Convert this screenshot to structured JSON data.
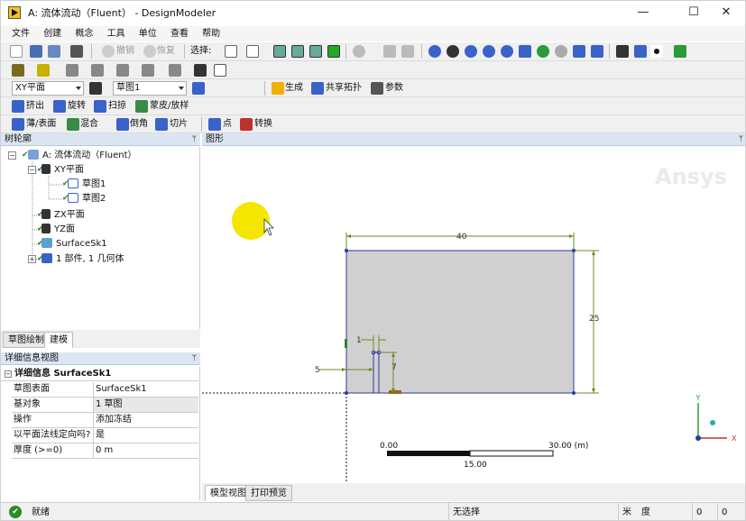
{
  "window": {
    "title": "A: 流体流动（Fluent） - DesignModeler",
    "minimize": "—",
    "maximize": "☐",
    "close": "✕"
  },
  "menu": [
    "文件",
    "创建",
    "概念",
    "工具",
    "单位",
    "查看",
    "帮助"
  ],
  "toolbar1": {
    "undo": "撤销",
    "redo": "恢复",
    "select_label": "选择:"
  },
  "toolbar3": {
    "plane": "XY平面",
    "sketch": "草图1",
    "generate": "生成",
    "share_topology": "共享拓扑",
    "parameters": "参数"
  },
  "toolbar4": {
    "extrude": "挤出",
    "revolve": "旋转",
    "sweep": "扫掠",
    "skin_loft": "蒙皮/放样"
  },
  "toolbar5": {
    "thin_surface": "薄/表面",
    "blend": "混合",
    "chamfer": "倒角",
    "slice": "切片",
    "point": "点",
    "convert": "转换"
  },
  "tree_panel": {
    "title": "树轮廓",
    "pin": "ᛘ",
    "nodes": [
      {
        "label": "A: 流体流动（Fluent）"
      },
      {
        "label": "XY平面"
      },
      {
        "label": "草图1"
      },
      {
        "label": "草图2"
      },
      {
        "label": "ZX平面"
      },
      {
        "label": "YZ面"
      },
      {
        "label": "SurfaceSk1"
      },
      {
        "label": "1 部件, 1 几何体"
      }
    ]
  },
  "left_tabs": {
    "sketching": "草图绘制",
    "modeling": "建模"
  },
  "detail_panel": {
    "title": "详细信息视图",
    "section": "详细信息 SurfaceSk1",
    "rows": [
      {
        "key": "草图表面",
        "value": "SurfaceSk1"
      },
      {
        "key": "基对象",
        "value": "1 草图"
      },
      {
        "key": "操作",
        "value": "添加冻结"
      },
      {
        "key": "以平面法线定向吗?",
        "value": "是"
      },
      {
        "key": "厚度 (>=0)",
        "value": "0 m"
      }
    ]
  },
  "graphics": {
    "title": "图形",
    "watermark": "Ansys",
    "dimensions": {
      "width": "40",
      "height": "25",
      "offset": "5",
      "slot_width": "1",
      "slot_height": "7"
    },
    "scale_bar": {
      "left": "0.00",
      "right": "30.00 (m)",
      "mid": "15.00"
    },
    "axes": {
      "y": "Y",
      "x": "X"
    }
  },
  "bottom_tabs": {
    "model_view": "模型视图",
    "print_preview": "打印预览"
  },
  "status": {
    "ready": "就绪",
    "selection": "无选择",
    "length_unit": "米",
    "angle_unit": "度",
    "c1": "0",
    "c2": "0"
  },
  "colors": {
    "accent": "#3a63c9",
    "dim": "#6b8e23",
    "check": "#2a8a2a",
    "cursor_highlight": "#f5e600"
  }
}
